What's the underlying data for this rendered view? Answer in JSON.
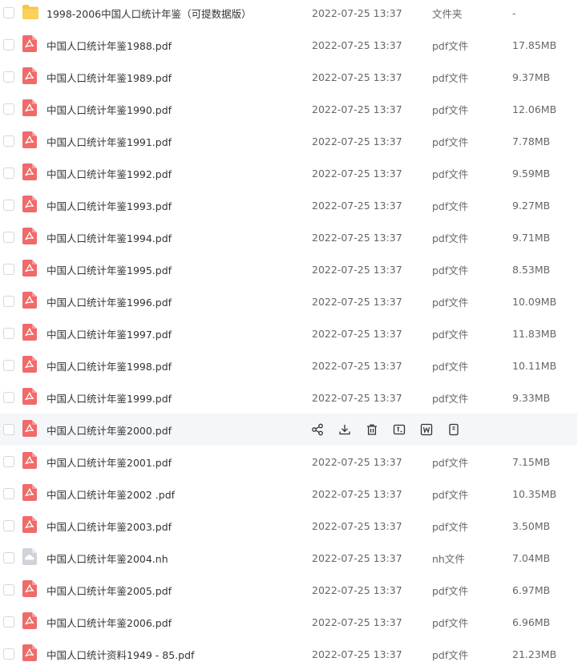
{
  "colors": {
    "pdf_icon": "#f06a6a",
    "folder_icon": "#f8c444",
    "nh_icon": "#cfd3da",
    "hover_row_bg": "#f5f6fa"
  },
  "hover_actions": [
    {
      "name": "share-icon"
    },
    {
      "name": "download-icon"
    },
    {
      "name": "delete-icon"
    },
    {
      "name": "text-extract-icon"
    },
    {
      "name": "convert-word-icon"
    },
    {
      "name": "more-file-icon"
    }
  ],
  "files": [
    {
      "name": "1998-2006中国人口统计年鉴（可提数据版）",
      "date": "2022-07-25 13:37",
      "type": "文件夹",
      "size": "-",
      "icon": "folder-icon",
      "hovered": false
    },
    {
      "name": "中国人口统计年鉴1988.pdf",
      "date": "2022-07-25 13:37",
      "type": "pdf文件",
      "size": "17.85MB",
      "icon": "pdf-icon",
      "hovered": false
    },
    {
      "name": "中国人口统计年鉴1989.pdf",
      "date": "2022-07-25 13:37",
      "type": "pdf文件",
      "size": "9.37MB",
      "icon": "pdf-icon",
      "hovered": false
    },
    {
      "name": "中国人口统计年鉴1990.pdf",
      "date": "2022-07-25 13:37",
      "type": "pdf文件",
      "size": "12.06MB",
      "icon": "pdf-icon",
      "hovered": false
    },
    {
      "name": "中国人口统计年鉴1991.pdf",
      "date": "2022-07-25 13:37",
      "type": "pdf文件",
      "size": "7.78MB",
      "icon": "pdf-icon",
      "hovered": false
    },
    {
      "name": "中国人口统计年鉴1992.pdf",
      "date": "2022-07-25 13:37",
      "type": "pdf文件",
      "size": "9.59MB",
      "icon": "pdf-icon",
      "hovered": false
    },
    {
      "name": "中国人口统计年鉴1993.pdf",
      "date": "2022-07-25 13:37",
      "type": "pdf文件",
      "size": "9.27MB",
      "icon": "pdf-icon",
      "hovered": false
    },
    {
      "name": "中国人口统计年鉴1994.pdf",
      "date": "2022-07-25 13:37",
      "type": "pdf文件",
      "size": "9.71MB",
      "icon": "pdf-icon",
      "hovered": false
    },
    {
      "name": "中国人口统计年鉴1995.pdf",
      "date": "2022-07-25 13:37",
      "type": "pdf文件",
      "size": "8.53MB",
      "icon": "pdf-icon",
      "hovered": false
    },
    {
      "name": "中国人口统计年鉴1996.pdf",
      "date": "2022-07-25 13:37",
      "type": "pdf文件",
      "size": "10.09MB",
      "icon": "pdf-icon",
      "hovered": false
    },
    {
      "name": "中国人口统计年鉴1997.pdf",
      "date": "2022-07-25 13:37",
      "type": "pdf文件",
      "size": "11.83MB",
      "icon": "pdf-icon",
      "hovered": false
    },
    {
      "name": "中国人口统计年鉴1998.pdf",
      "date": "2022-07-25 13:37",
      "type": "pdf文件",
      "size": "10.11MB",
      "icon": "pdf-icon",
      "hovered": false
    },
    {
      "name": "中国人口统计年鉴1999.pdf",
      "date": "2022-07-25 13:37",
      "type": "pdf文件",
      "size": "9.33MB",
      "icon": "pdf-icon",
      "hovered": false
    },
    {
      "name": "中国人口统计年鉴2000.pdf",
      "date": "",
      "type": "",
      "size": "",
      "icon": "pdf-icon",
      "hovered": true
    },
    {
      "name": "中国人口统计年鉴2001.pdf",
      "date": "2022-07-25 13:37",
      "type": "pdf文件",
      "size": "7.15MB",
      "icon": "pdf-icon",
      "hovered": false
    },
    {
      "name": "中国人口统计年鉴2002 .pdf",
      "date": "2022-07-25 13:37",
      "type": "pdf文件",
      "size": "10.35MB",
      "icon": "pdf-icon",
      "hovered": false
    },
    {
      "name": "中国人口统计年鉴2003.pdf",
      "date": "2022-07-25 13:37",
      "type": "pdf文件",
      "size": "3.50MB",
      "icon": "pdf-icon",
      "hovered": false
    },
    {
      "name": "中国人口统计年鉴2004.nh",
      "date": "2022-07-25 13:37",
      "type": "nh文件",
      "size": "7.04MB",
      "icon": "nh-file-icon",
      "hovered": false
    },
    {
      "name": "中国人口统计年鉴2005.pdf",
      "date": "2022-07-25 13:37",
      "type": "pdf文件",
      "size": "6.97MB",
      "icon": "pdf-icon",
      "hovered": false
    },
    {
      "name": "中国人口统计年鉴2006.pdf",
      "date": "2022-07-25 13:37",
      "type": "pdf文件",
      "size": "6.96MB",
      "icon": "pdf-icon",
      "hovered": false
    },
    {
      "name": "中国人口统计资料1949 - 85.pdf",
      "date": "2022-07-25 13:37",
      "type": "pdf文件",
      "size": "21.23MB",
      "icon": "pdf-icon",
      "hovered": false
    }
  ]
}
